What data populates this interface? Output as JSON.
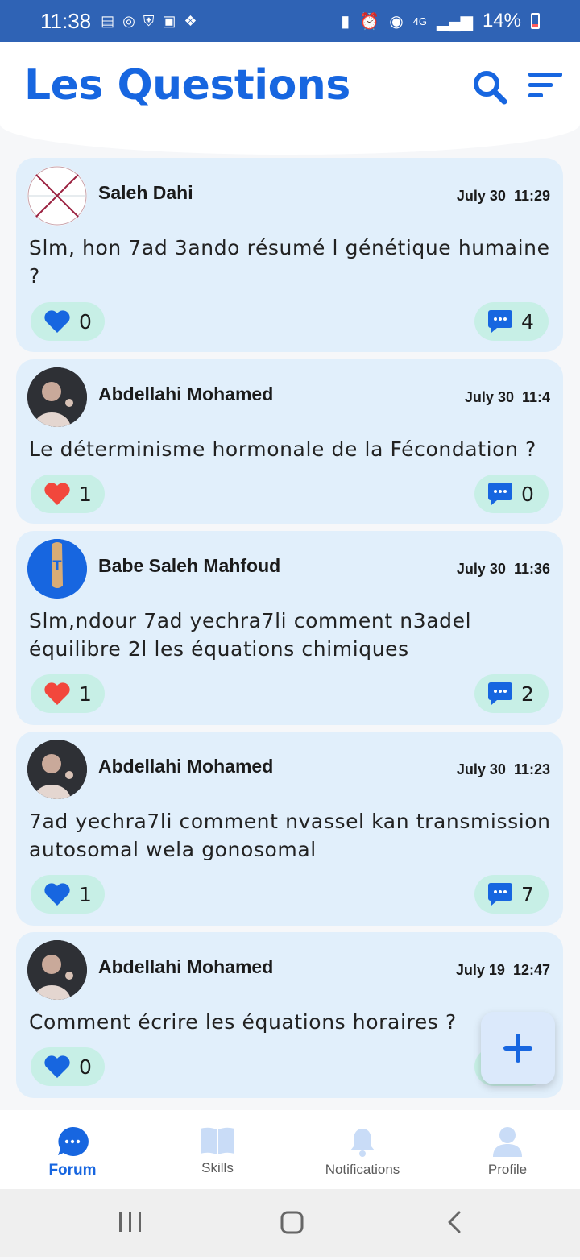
{
  "status_bar": {
    "time": "11:38",
    "battery": "14%",
    "network": "4G"
  },
  "header": {
    "title": "Les Questions"
  },
  "posts": [
    {
      "author": "Saleh Dahi",
      "date": "July 30  11:29",
      "question": "Slm, hon 7ad 3ando résumé l génétique humaine ?",
      "likes": "0",
      "liked": false,
      "comments": "4",
      "avatar": "broken-image"
    },
    {
      "author": "Abdellahi Mohamed",
      "date": "July 30  11:4",
      "question": "Le déterminisme hormonale de la Fécondation ?",
      "likes": "1",
      "liked": true,
      "comments": "0",
      "avatar": "photo"
    },
    {
      "author": "Babe Saleh  Mahfoud",
      "date": "July 30  11:36",
      "question": "Slm,ndour 7ad yechra7li comment n3adel équilibre 2l les équations chimiques",
      "likes": "1",
      "liked": true,
      "comments": "2",
      "avatar": "letter-t"
    },
    {
      "author": "Abdellahi Mohamed",
      "date": "July 30  11:23",
      "question": "7ad yechra7li comment nvassel kan transmission autosomal wela gonosomal",
      "likes": "1",
      "liked": false,
      "comments": "7",
      "avatar": "photo"
    },
    {
      "author": "Abdellahi Mohamed",
      "date": "July 19  12:47",
      "question": "Comment écrire les équations horaires ?",
      "likes": "0",
      "liked": false,
      "comments": "",
      "avatar": "photo"
    }
  ],
  "nav": {
    "items": [
      {
        "label": "Forum",
        "icon": "chat-bubble-icon",
        "active": true
      },
      {
        "label": "Skills",
        "icon": "book-icon",
        "active": false
      },
      {
        "label": "Notifications",
        "icon": "bell-icon",
        "active": false
      },
      {
        "label": "Profile",
        "icon": "person-icon",
        "active": false
      }
    ]
  },
  "colors": {
    "accent": "#1766e0",
    "card": "#e1effb",
    "pill": "#c7efe6",
    "like_active": "#f2473c",
    "status_bar": "#2f63b5"
  }
}
